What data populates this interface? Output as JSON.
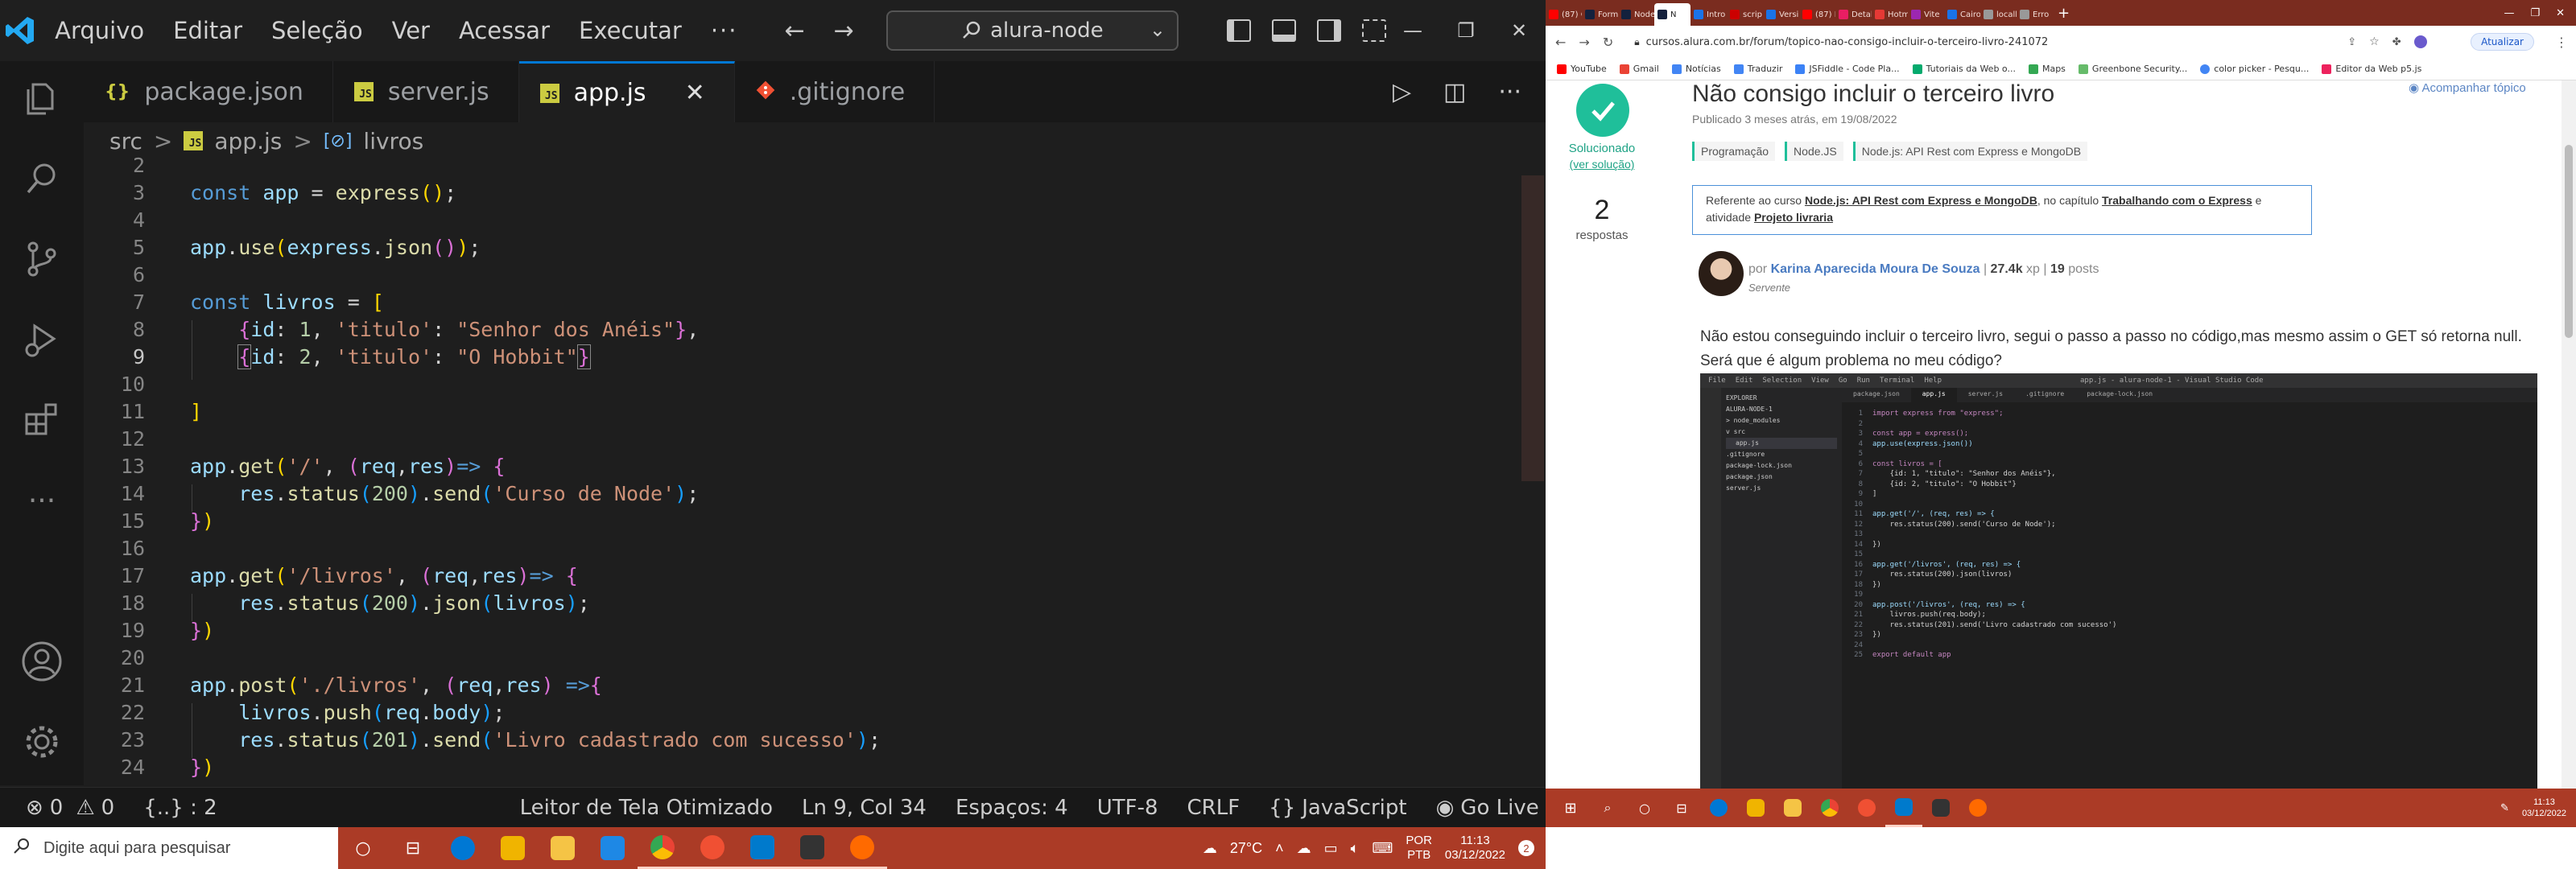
{
  "vscode": {
    "menu": [
      "Arquivo",
      "Editar",
      "Seleção",
      "Ver",
      "Acessar",
      "Executar",
      "···"
    ],
    "search_text": "alura-node",
    "tabs": [
      {
        "label": "package.json",
        "icon": "{}",
        "icon_color": "#cbcb41"
      },
      {
        "label": "server.js",
        "icon": "JS",
        "icon_color": "#cbcb41"
      },
      {
        "label": "app.js",
        "icon": "JS",
        "icon_color": "#cbcb41"
      },
      {
        "label": ".gitignore",
        "icon": "git",
        "icon_color": "#f05033"
      }
    ],
    "close_glyph": "✕",
    "breadcrumb": {
      "folder": "src",
      "sep": ">",
      "file": "app.js",
      "symbol": "livros",
      "symbol_icon": "[⊘]"
    },
    "line_numbers": [
      "2",
      "3",
      "4",
      "5",
      "6",
      "7",
      "8",
      "9",
      "10",
      "11",
      "12",
      "13",
      "14",
      "15",
      "16",
      "17",
      "18",
      "19",
      "20",
      "21",
      "22",
      "23",
      "24"
    ],
    "status": {
      "errors": "0",
      "warnings": "0",
      "braces": "{..} : 2",
      "screen_reader": "Leitor de Tela Otimizado",
      "position": "Ln 9, Col 34",
      "spaces": "Espaços: 4",
      "encoding": "UTF-8",
      "eol": "CRLF",
      "language": "JavaScript",
      "go_live": "Go Live"
    },
    "accent": "#0078d4"
  },
  "code_tokens": {
    "const": "const",
    "app": "app",
    "express": "express",
    "use": "use",
    "json": "json",
    "livros": "livros",
    "id": "id",
    "titulo": "'titulo'",
    "one": "1",
    "two": "2",
    "senhor": "\"Senhor dos Anéis\"",
    "hobbit": "\"O Hobbit\"",
    "get": "get",
    "root_path": "'/'",
    "req": "req",
    "res": "res",
    "status": "status",
    "c200": "200",
    "c201": "201",
    "send": "send",
    "curso": "'Curso de Node'",
    "livros_path": "'/livros'",
    "post": "post",
    "post_path": "'./livros'",
    "push": "push",
    "body": "body",
    "sucesso": "'Livro cadastrado com sucesso'",
    "arrow": "=>"
  },
  "browser": {
    "tabs": [
      "(87) C",
      "Form",
      "Node",
      "N",
      "Intro",
      "scrip",
      "Versi",
      "(87) N",
      "Detal",
      "Hotm",
      "Vite",
      "Cairo",
      "locall",
      "Erro"
    ],
    "active_tab_index": 3,
    "url": "cursos.alura.com.br/forum/topico-nao-consigo-incluir-o-terceiro-livro-241072",
    "update_label": "Atualizar",
    "bookmarks": [
      "YouTube",
      "Gmail",
      "Notícias",
      "Traduzir",
      "JSFiddle - Code Pla...",
      "Tutoriais da Web o...",
      "Maps",
      "Greenbone Security...",
      "color picker - Pesqu...",
      "Editor da Web p5.js"
    ],
    "page": {
      "solved_label": "Solucionado",
      "solved_link": "(ver solução)",
      "answers_count": "2",
      "answers_label": "respostas",
      "title": "Não consigo incluir o terceiro livro",
      "follow": "Acompanhar tópico",
      "meta": "Publicado 3 meses atrás, em 19/08/2022",
      "tags": [
        "Programação",
        "Node.JS",
        "Node.js: API Rest com Express e MongoDB"
      ],
      "course_prefix": "Referente ao curso",
      "course_name": "Node.js: API Rest com Express e MongoDB",
      "chapter_prefix": ", no capítulo",
      "chapter_name": "Trabalhando com o Express",
      "activity_prefix": "e atividade",
      "activity_name": "Projeto livraria",
      "author_prefix": "por",
      "author": "Karina Aparecida Moura De Souza",
      "xp": "27.4k",
      "xp_suffix": "xp",
      "posts": "19",
      "posts_suffix": "posts",
      "role": "Servente",
      "text": "Não estou conseguindo incluir o terceiro livro, segui o passo a passo no código,mas mesmo assim o GET só retorna null. Será que é algum problema no meu código?"
    },
    "shot": {
      "menu": [
        "File",
        "Edit",
        "Selection",
        "View",
        "Go",
        "Run",
        "Terminal",
        "Help"
      ],
      "window_title": "app.js - alura-node-1 - Visual Studio Code",
      "explorer": [
        "EXPLORER",
        "ALURA-NODE-1",
        "> node_modules",
        "v src",
        "app.js",
        ".gitignore",
        "package-lock.json",
        "package.json",
        "server.js"
      ],
      "tabs": [
        "package.json",
        "app.js",
        "server.js",
        ".gitignore",
        "package-lock.json"
      ],
      "code": [
        "import express from \"express\";",
        "",
        "const app = express();",
        "app.use(express.json())",
        "",
        "const livros = [",
        "    {id: 1, \"titulo\": \"Senhor dos Anéis\"},",
        "    {id: 2, \"titulo\": \"O Hobbit\"}",
        "]",
        "",
        "app.get('/', (req, res) => {",
        "    res.status(200).send('Curso de Node');",
        "",
        "})",
        "",
        "app.get('/livros', (req, res) => {",
        "    res.status(200).json(livros)",
        "})",
        "",
        "app.post('/livros', (req, res) => {",
        "    livros.push(req.body);",
        "    res.status(201).send('Livro cadastrado com sucesso')",
        "})",
        "",
        "export default app"
      ]
    }
  },
  "taskbar": {
    "search_placeholder": "Digite aqui para pesquisar",
    "weather": "27°C",
    "lang": "POR",
    "layout": "PTB",
    "time": "11:13",
    "date": "03/12/2022",
    "notif_count": "2",
    "app_colors": [
      "#0078d4",
      "#f0b400",
      "#1e88e5",
      "#34a853",
      "#f05033",
      "#007acc",
      "#333333",
      "#ff6a00"
    ]
  }
}
